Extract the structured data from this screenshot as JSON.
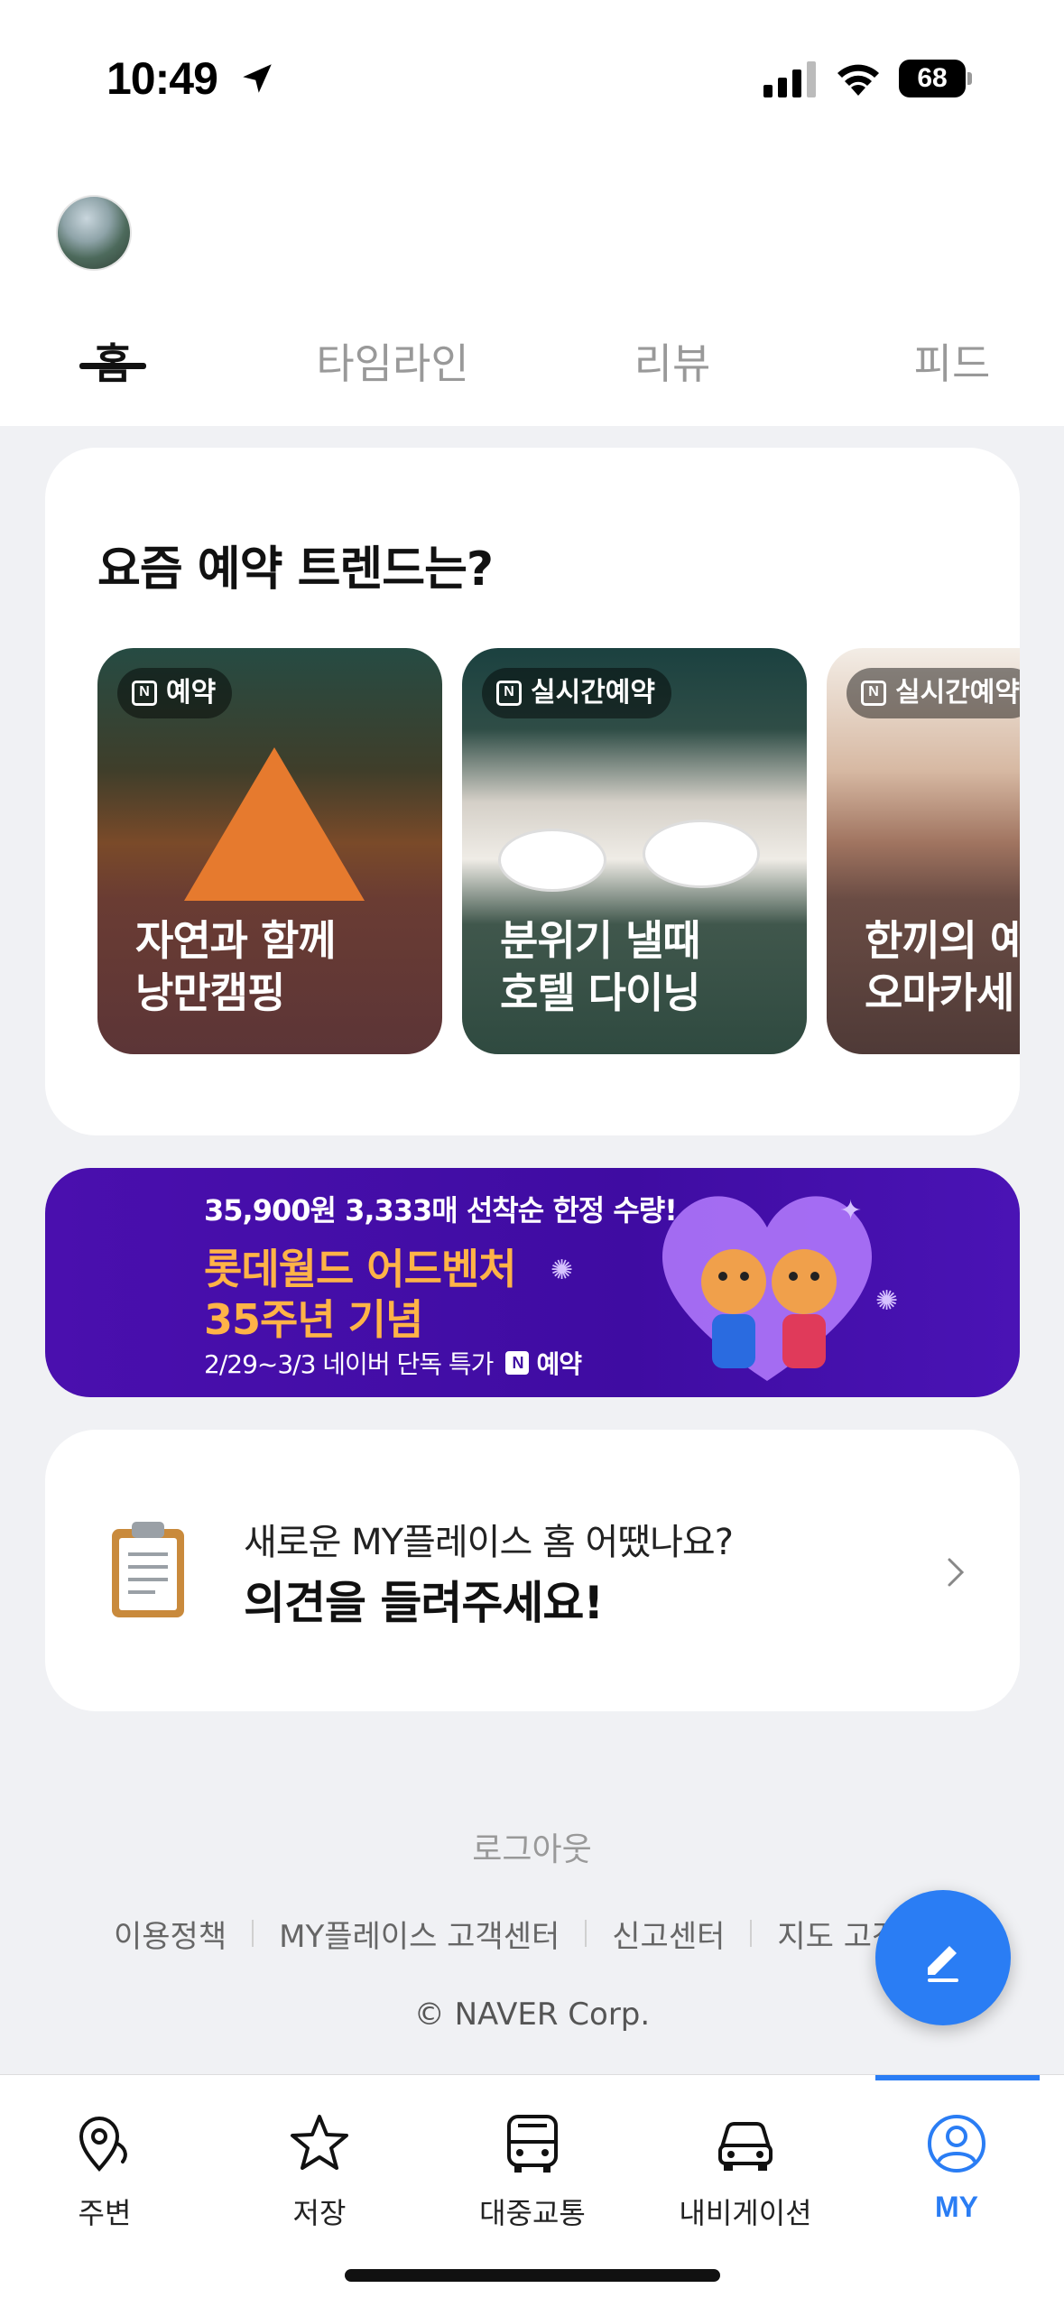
{
  "status_bar": {
    "time": "10:49",
    "battery": "68"
  },
  "profile": {
    "username": ""
  },
  "tabs": [
    {
      "label": "홈",
      "active": true
    },
    {
      "label": "타임라인",
      "active": false
    },
    {
      "label": "리뷰",
      "active": false
    },
    {
      "label": "피드",
      "active": false
    }
  ],
  "trend": {
    "title": "요즘 예약 트렌드는?",
    "items": [
      {
        "badge": "예약",
        "line1": "자연과 함께",
        "line2": "낭만캠핑"
      },
      {
        "badge": "실시간예약",
        "line1": "분위기 낼때",
        "line2": "호텔 다이닝"
      },
      {
        "badge": "실시간예약",
        "line1": "한끼의 예",
        "line2": "오마카세"
      }
    ]
  },
  "banner": {
    "line1": "35,900원 3,333매 선착순 한정 수량!",
    "line2": "롯데월드 어드벤처",
    "line3": "35주년 기념",
    "line4": "2/29~3/3 네이버 단독 특가",
    "badge": "예약",
    "badge_icon": "N"
  },
  "feedback": {
    "line1": "새로운 MY플레이스 홈 어땠나요?",
    "line2": "의견을 들려주세요!"
  },
  "footer": {
    "logout": "로그아웃",
    "links": [
      "이용정책",
      "MY플레이스 고객센터",
      "신고센터",
      "지도 고객"
    ],
    "copyright": "© NAVER Corp."
  },
  "nav": [
    {
      "label": "주변",
      "icon": "location-pin-icon"
    },
    {
      "label": "저장",
      "icon": "star-icon"
    },
    {
      "label": "대중교통",
      "icon": "bus-icon"
    },
    {
      "label": "내비게이션",
      "icon": "car-icon"
    },
    {
      "label": "MY",
      "icon": "profile-icon",
      "active": true
    }
  ],
  "colors": {
    "accent": "#2a7df4",
    "banner_bg": "#4a0fae",
    "banner_highlight": "#ffb347"
  }
}
